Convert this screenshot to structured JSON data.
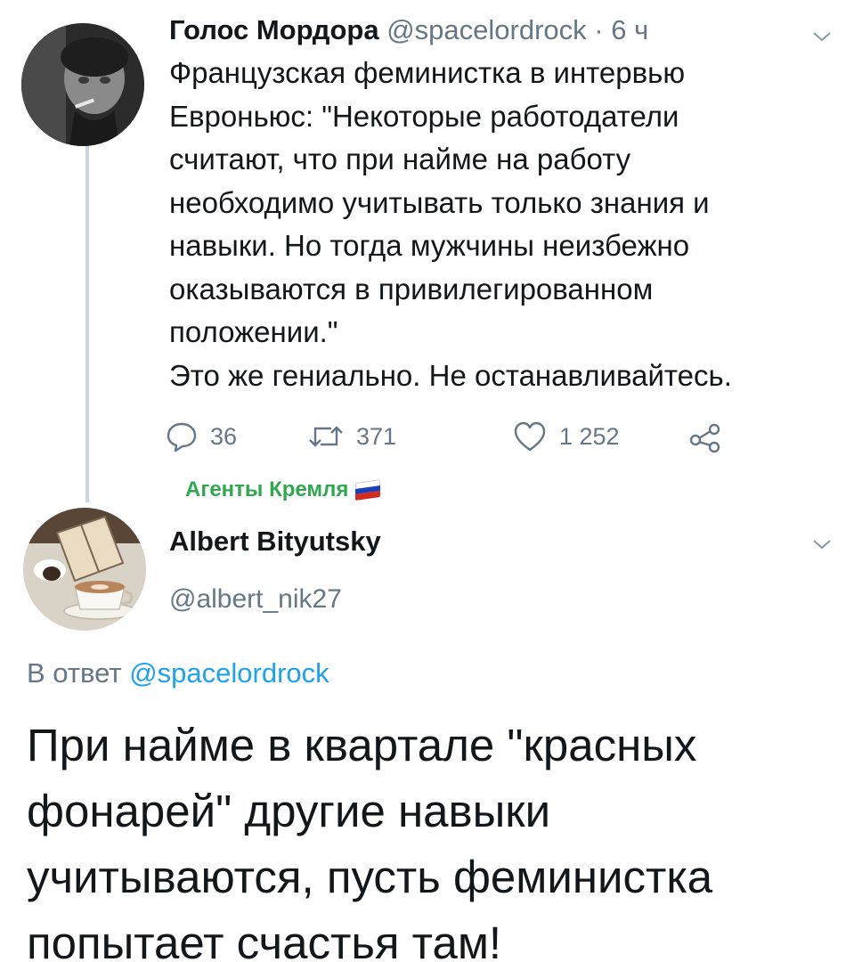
{
  "tweet": {
    "author_name": "Голос Мордора",
    "author_handle": "@spacelordrock",
    "separator": " · ",
    "time": "6 ч",
    "text_lines": [
      "Французская феминистка в интервью",
      "Евроньюс: \"Некоторые работодатели",
      "считают, что при найме на работу",
      "необходимо учитывать только знания и",
      "навыки. Но тогда мужчины неизбежно",
      "оказываются в привилегированном",
      "положении.\"",
      "Это же гениально. Не останавливайтесь."
    ],
    "replies_count": "36",
    "retweets_count": "371",
    "likes_count": "1 252"
  },
  "list_label": "Агенты Кремля",
  "flag_colors": [
    "#ffffff",
    "#1c3fb8",
    "#d52b1e"
  ],
  "reply": {
    "author_name": "Albert Bityutsky",
    "author_handle": "@albert_nik27",
    "reply_prefix": "В ответ",
    "reply_mention": "@spacelordrock",
    "text": "При найме в квартале \"красных фонарей\" другие навыки учитываются, пусть феминистка попытает счастья там!"
  },
  "icons": [
    "avatar",
    "chevron-down-icon",
    "reply-icon",
    "retweet-icon",
    "like-icon",
    "share-icon",
    "russian-flag-icon"
  ],
  "colors": {
    "text": "#14171a",
    "secondary": "#657786",
    "link": "#1da1f2",
    "list_label": "#2fa84f",
    "thread_line": "#ccd6dd"
  }
}
